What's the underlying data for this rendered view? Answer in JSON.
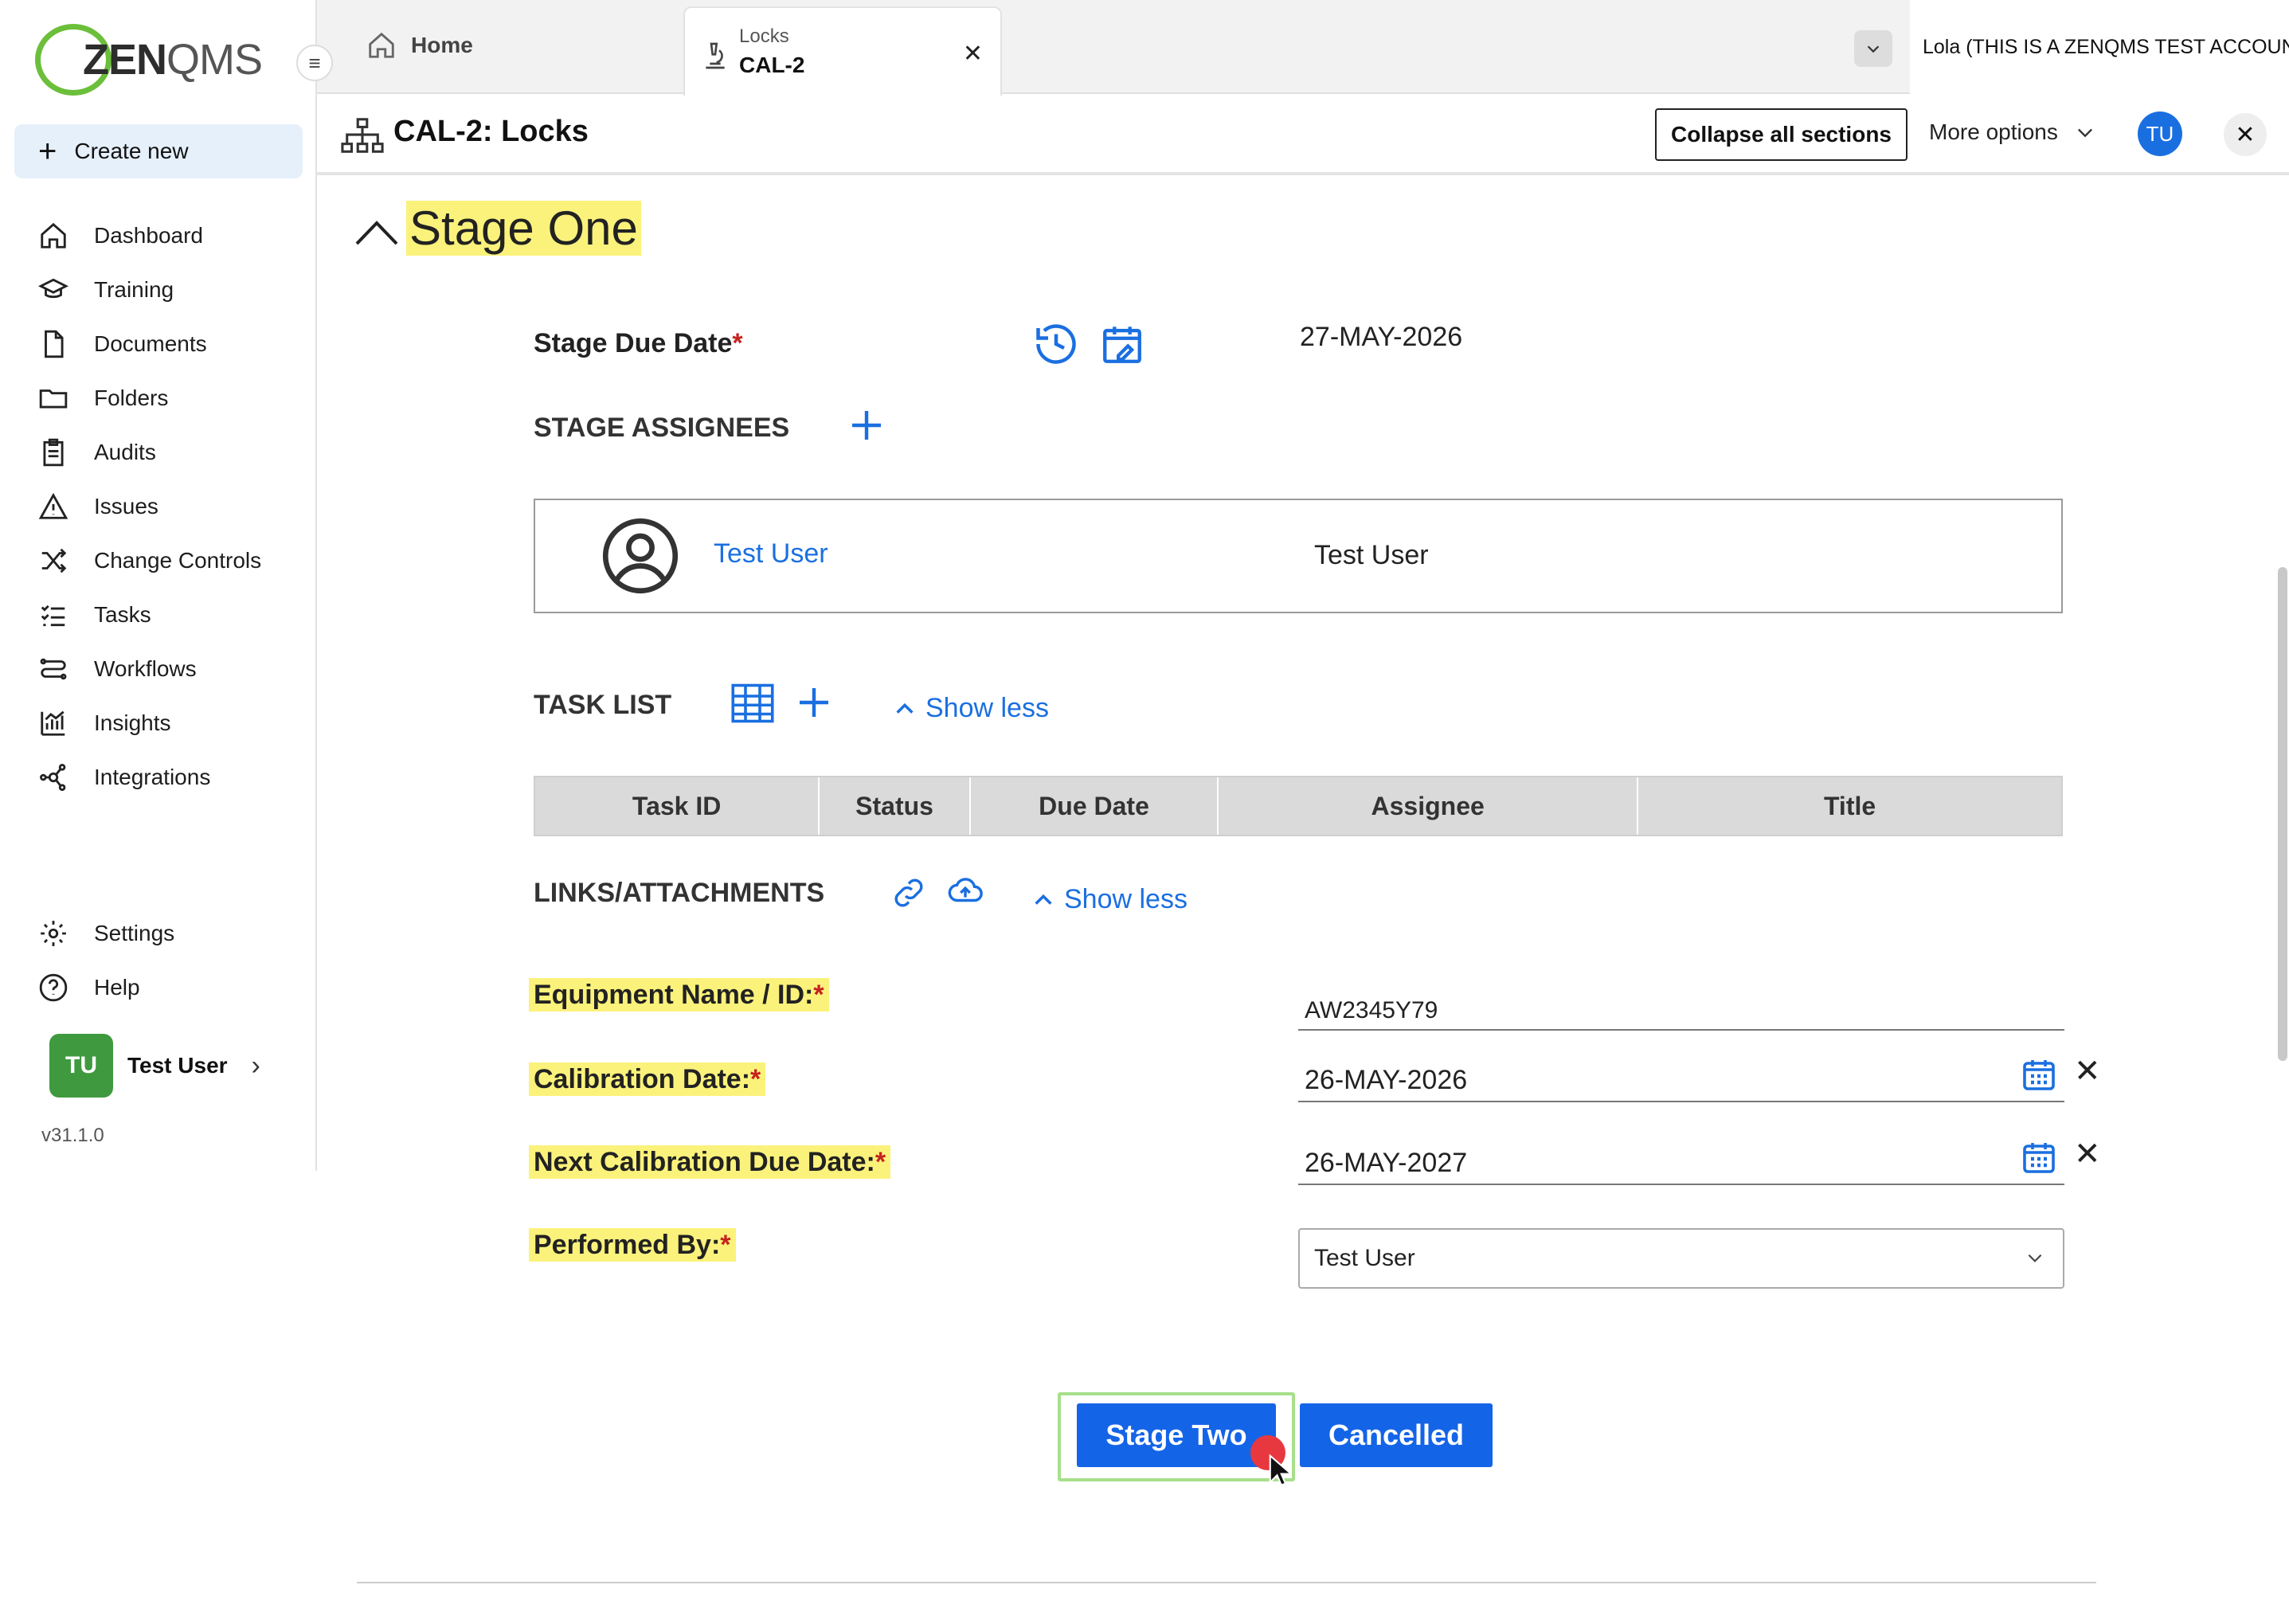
{
  "app": {
    "logo_text_bold": "ZEN",
    "logo_text_light": "QMS",
    "version": "v31.1.0"
  },
  "sidebar": {
    "create_new": "Create new",
    "items": [
      {
        "label": "Dashboard",
        "icon": "home-icon"
      },
      {
        "label": "Training",
        "icon": "graduation-cap-icon"
      },
      {
        "label": "Documents",
        "icon": "document-icon"
      },
      {
        "label": "Folders",
        "icon": "folder-icon"
      },
      {
        "label": "Audits",
        "icon": "clipboard-icon"
      },
      {
        "label": "Issues",
        "icon": "warning-icon"
      },
      {
        "label": "Change Controls",
        "icon": "shuffle-icon"
      },
      {
        "label": "Tasks",
        "icon": "checklist-icon"
      },
      {
        "label": "Workflows",
        "icon": "workflow-icon"
      },
      {
        "label": "Insights",
        "icon": "chart-icon"
      },
      {
        "label": "Integrations",
        "icon": "network-icon"
      }
    ],
    "bottom_items": [
      {
        "label": "Settings",
        "icon": "gear-icon"
      },
      {
        "label": "Help",
        "icon": "help-icon"
      }
    ],
    "user": {
      "initials": "TU",
      "name": "Test User"
    }
  },
  "tabs": {
    "home": "Home",
    "active_small": "Locks",
    "active_big": "CAL-2",
    "account": "Lola (THIS IS A ZENQMS TEST ACCOUNT)"
  },
  "header": {
    "title": "CAL-2: Locks",
    "collapse_all": "Collapse all sections",
    "more_options": "More options",
    "avatar": "TU"
  },
  "stage": {
    "title": "Stage One",
    "due_date_label": "Stage Due Date",
    "due_date_value": "27-MAY-2026",
    "assignees_label": "STAGE ASSIGNEES",
    "assignee_link": "Test User",
    "assignee_name": "Test User",
    "task_list_label": "TASK LIST",
    "show_less": "Show less",
    "task_columns": [
      "Task ID",
      "Status",
      "Due Date",
      "Assignee",
      "Title"
    ],
    "links_label": "LINKS/ATTACHMENTS",
    "links_show_less": "Show less",
    "fields": {
      "equipment_label": "Equipment Name / ID:",
      "equipment_value": "AW2345Y79",
      "calibration_label": "Calibration Date:",
      "calibration_value": "26-MAY-2026",
      "next_calibration_label": "Next Calibration Due Date:",
      "next_calibration_value": "26-MAY-2027",
      "performed_by_label": "Performed By:",
      "performed_by_value": "Test User"
    },
    "required_mark": "*",
    "buttons": {
      "stage_two": "Stage Two",
      "cancelled": "Cancelled"
    }
  },
  "colors": {
    "accent": "#1464e8",
    "highlight": "#fbf27b",
    "logo_green": "#6bbf3a"
  }
}
